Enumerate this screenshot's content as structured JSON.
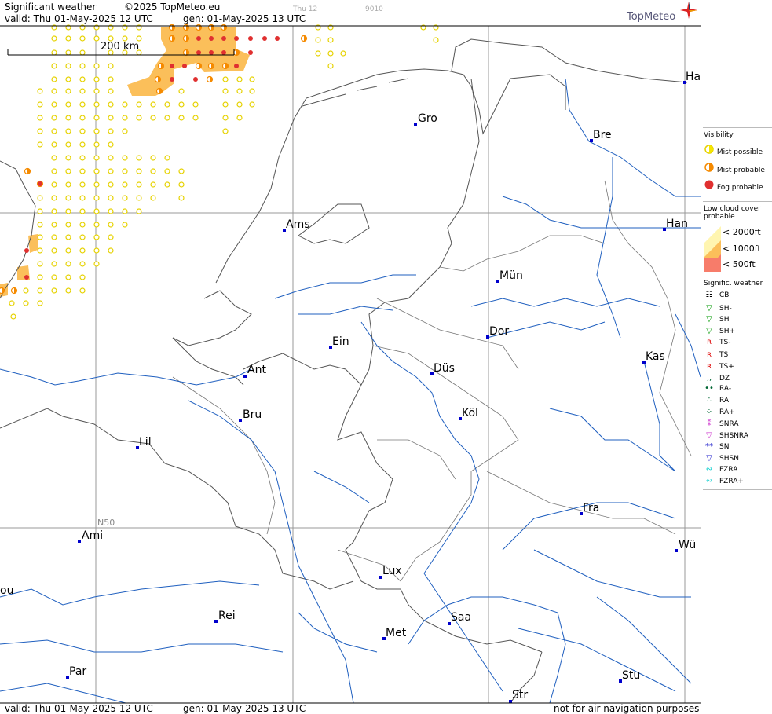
{
  "header": {
    "title": "Significant weather",
    "copyright": "©2025 TopMeteo.eu",
    "valid": "valid:  Thu  01-May-2025  12 UTC",
    "gen": "gen: 01-May-2025 13 UTC",
    "faint_time": "Thu 12",
    "faint_code": "9010",
    "logo": "TopMeteo"
  },
  "footer": {
    "valid": "valid:  Thu  01-May-2025  12 UTC",
    "gen": "gen: 01-May-2025 13 UTC",
    "disclaimer": "not for air navigation purposes"
  },
  "map": {
    "scale_label": "200 km",
    "lat_label": "N50",
    "cities": [
      {
        "name": "Ha",
        "key": "ha"
      },
      {
        "name": "Gro",
        "key": "gro"
      },
      {
        "name": "Bre",
        "key": "bre"
      },
      {
        "name": "Ams",
        "key": "ams"
      },
      {
        "name": "Han",
        "key": "han"
      },
      {
        "name": "Mün",
        "key": "mun"
      },
      {
        "name": "Dor",
        "key": "dor"
      },
      {
        "name": "Ein",
        "key": "ein"
      },
      {
        "name": "Kas",
        "key": "kas"
      },
      {
        "name": "Ant",
        "key": "ant"
      },
      {
        "name": "Düs",
        "key": "dus"
      },
      {
        "name": "Köl",
        "key": "kol"
      },
      {
        "name": "Bru",
        "key": "bru"
      },
      {
        "name": "Lil",
        "key": "lil"
      },
      {
        "name": "Fra",
        "key": "fra"
      },
      {
        "name": "Ami",
        "key": "ami"
      },
      {
        "name": "Wü",
        "key": "wu"
      },
      {
        "name": "Lux",
        "key": "lux"
      },
      {
        "name": "ou",
        "key": "ou"
      },
      {
        "name": "Rei",
        "key": "rei"
      },
      {
        "name": "Saa",
        "key": "saa"
      },
      {
        "name": "Met",
        "key": "met"
      },
      {
        "name": "Par",
        "key": "par"
      },
      {
        "name": "Stu",
        "key": "stu"
      },
      {
        "name": "Str",
        "key": "str"
      }
    ]
  },
  "legend": {
    "visibility_title": "Visibility",
    "visibility_items": [
      "Mist possible",
      "Mist probable",
      "Fog probable"
    ],
    "lowcloud_title_1": "Low cloud cover",
    "lowcloud_title_2": "probable",
    "lowcloud_items": [
      "< 2000ft",
      "< 1000ft",
      "<   500ft"
    ],
    "sigwx_title": "Signific. weather",
    "sigwx_items": [
      "CB",
      "SH-",
      "SH",
      "SH+",
      "TS-",
      "TS",
      "TS+",
      "DZ",
      "RA-",
      "RA",
      "RA+",
      "SNRA",
      "SHSNRA",
      "SN",
      "SHSN",
      "FZRA",
      "FZRA+"
    ]
  },
  "colors": {
    "mist_possible": "#f5e600",
    "mist_probable": "#f58a00",
    "fog_probable": "#e03030",
    "cloud_2000": "#fff5b0",
    "cloud_1000": "#fbbf5a",
    "cloud_500": "#f77c6a",
    "border": "#555555",
    "river": "#1f5fbf",
    "city": "#0000cc"
  }
}
